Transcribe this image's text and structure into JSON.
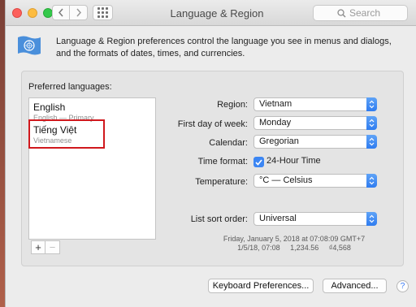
{
  "window": {
    "title": "Language & Region"
  },
  "search": {
    "placeholder": "Search"
  },
  "intro": "Language & Region preferences control the language you see in menus and dialogs, and the formats of dates, times, and currencies.",
  "preferred": {
    "label": "Preferred languages:",
    "languages": [
      {
        "name": "English",
        "sub": "English — Primary"
      },
      {
        "name": "Tiếng Việt",
        "sub": "Vietnamese"
      }
    ],
    "add_label": "+",
    "remove_label": "−"
  },
  "settings": {
    "region": {
      "label": "Region:",
      "value": "Vietnam"
    },
    "first_day": {
      "label": "First day of week:",
      "value": "Monday"
    },
    "calendar": {
      "label": "Calendar:",
      "value": "Gregorian"
    },
    "time_format": {
      "label": "Time format:",
      "value": "24-Hour Time",
      "checked": true
    },
    "temperature": {
      "label": "Temperature:",
      "value": "°C — Celsius"
    },
    "sort_order": {
      "label": "List sort order:",
      "value": "Universal"
    }
  },
  "sample": {
    "line1": "Friday, January 5, 2018 at 07:08:09 GMT+7",
    "line2": "1/5/18, 07:08     1,234.56     ₫4,568"
  },
  "buttons": {
    "keyboard": "Keyboard Preferences...",
    "advanced": "Advanced...",
    "help": "?"
  },
  "colors": {
    "accent": "#3c86f3",
    "highlight_box": "#d0181d"
  }
}
